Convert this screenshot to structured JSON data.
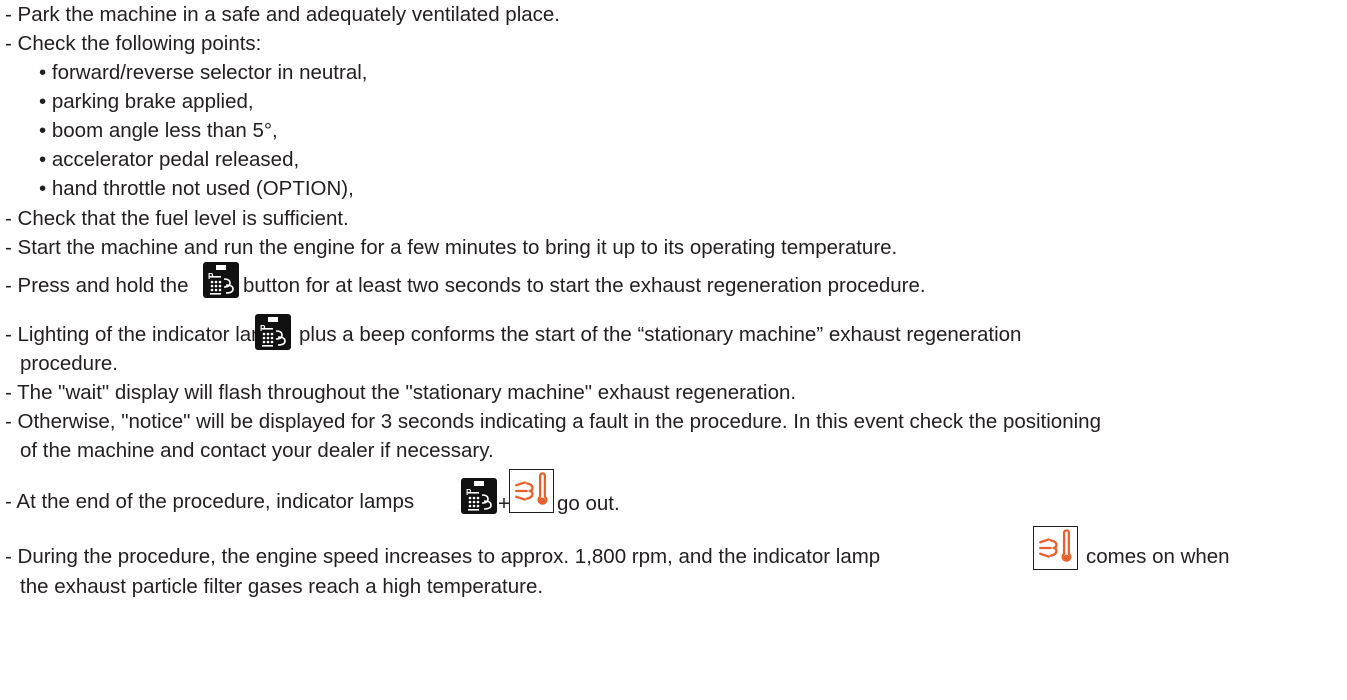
{
  "lines": [
    "- Park the machine in a safe and adequately ventilated place.",
    "- Check the following points:",
    "• forward/reverse selector in neutral,",
    "• parking brake applied,",
    "• boom angle less than 5°,",
    "• accelerator pedal released,",
    "• hand throttle not used (OPTION),",
    "- Check that the fuel level is sufficient.",
    "- Start the machine and run the engine for a few minutes to bring it up to its operating temperature."
  ],
  "press_hold": {
    "before": "- Press and hold the",
    "after": "button for at least two seconds to start the exhaust regeneration procedure."
  },
  "lighting": {
    "before": "- Lighting of the indicator lamp",
    "after": "plus a beep conforms the start of the “stationary machine” exhaust regeneration",
    "cont": "procedure."
  },
  "wait_line": "- The \"wait\" display will flash throughout the \"stationary machine\" exhaust regeneration.",
  "otherwise": {
    "line1": "- Otherwise, \"notice\" will be displayed for 3 seconds indicating a fault in the procedure. In this event check the positioning",
    "line2": "of the machine and contact your dealer if necessary."
  },
  "end": {
    "before": "- At the end of the procedure, indicator lamps",
    "plus": "+",
    "after": "go out."
  },
  "during": {
    "before": "- During the procedure, the engine speed increases to approx. 1,800 rpm, and the indicator lamp",
    "after": "comes on when",
    "line2": "the exhaust particle filter gases reach a high temperature."
  },
  "icons": {
    "regeneration_button": "exhaust-regeneration-icon",
    "high_temperature_lamp": "exhaust-high-temperature-icon",
    "temp_icon_color": "#e8602c"
  }
}
